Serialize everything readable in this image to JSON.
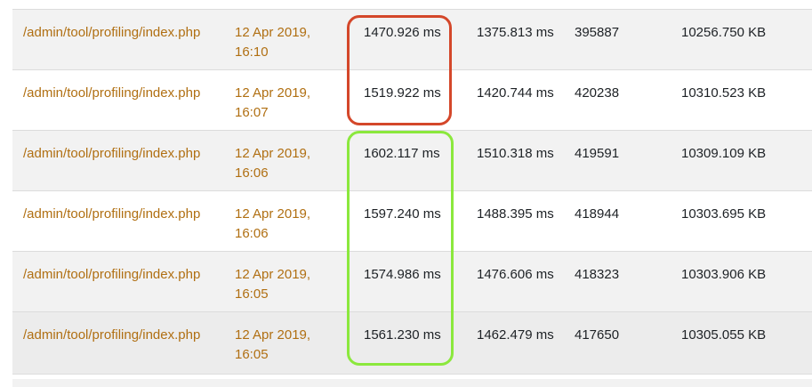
{
  "highlight_colors": {
    "red": "#d4472a",
    "green": "#8be83d"
  },
  "link_color": "#b06f12",
  "rows": [
    {
      "url": "/admin/tool/profiling/index.php",
      "time": "12 Apr 2019, 16:10",
      "total": "1470.926 ms",
      "server": "1375.813 ms",
      "queries": "395887",
      "memory": "10256.750 KB"
    },
    {
      "url": "/admin/tool/profiling/index.php",
      "time": "12 Apr 2019, 16:07",
      "total": "1519.922 ms",
      "server": "1420.744 ms",
      "queries": "420238",
      "memory": "10310.523 KB"
    },
    {
      "url": "/admin/tool/profiling/index.php",
      "time": "12 Apr 2019, 16:06",
      "total": "1602.117 ms",
      "server": "1510.318 ms",
      "queries": "419591",
      "memory": "10309.109 KB"
    },
    {
      "url": "/admin/tool/profiling/index.php",
      "time": "12 Apr 2019, 16:06",
      "total": "1597.240 ms",
      "server": "1488.395 ms",
      "queries": "418944",
      "memory": "10303.695 KB"
    },
    {
      "url": "/admin/tool/profiling/index.php",
      "time": "12 Apr 2019, 16:05",
      "total": "1574.986 ms",
      "server": "1476.606 ms",
      "queries": "418323",
      "memory": "10303.906 KB"
    },
    {
      "url": "/admin/tool/profiling/index.php",
      "time": "12 Apr 2019, 16:05",
      "total": "1561.230 ms",
      "server": "1462.479 ms",
      "queries": "417650",
      "memory": "10305.055 KB"
    }
  ]
}
